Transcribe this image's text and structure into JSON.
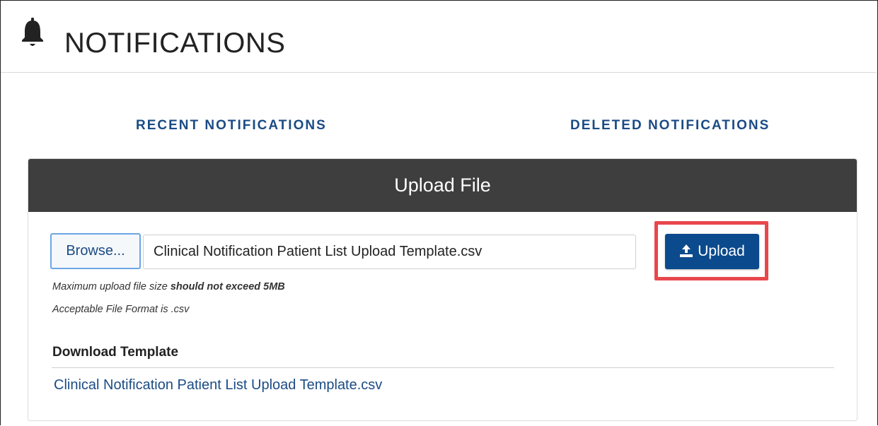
{
  "header": {
    "icon": "bell-icon",
    "title": "NOTIFICATIONS"
  },
  "tabs": [
    {
      "label": "RECENT NOTIFICATIONS"
    },
    {
      "label": "DELETED NOTIFICATIONS"
    }
  ],
  "upload_panel": {
    "title": "Upload File",
    "browse_label": "Browse...",
    "selected_file": "Clinical Notification Patient List Upload Template.csv",
    "upload_label": "Upload",
    "upload_icon": "upload-icon",
    "hint_size_prefix": "Maximum upload file size ",
    "hint_size_bold": "should not exceed 5MB",
    "hint_format": "Acceptable File Format is .csv"
  },
  "download": {
    "heading": "Download Template",
    "link_text": "Clinical Notification Patient List Upload Template.csv"
  },
  "colors": {
    "accent": "#1b4b85",
    "upload_button": "#0b4a8d",
    "panel_header": "#3e3e3e",
    "highlight": "#e8474c"
  }
}
